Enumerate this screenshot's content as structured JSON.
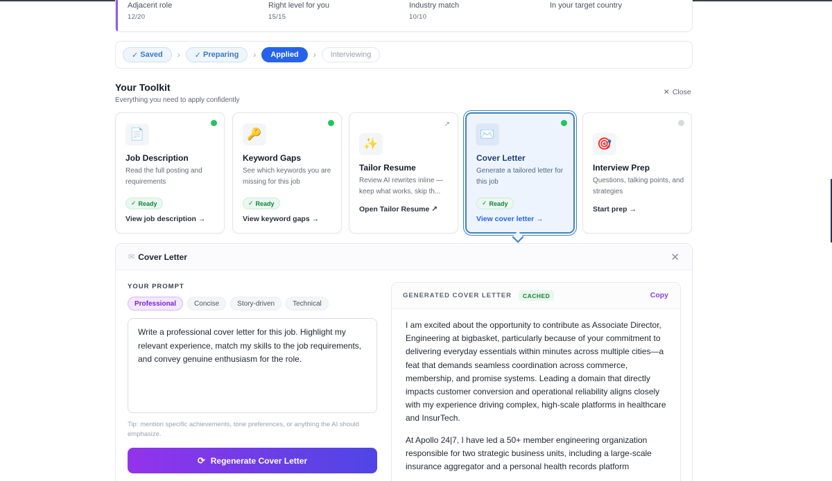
{
  "metrics": [
    {
      "label": "Adjacent role",
      "value": "12/20"
    },
    {
      "label": "Right level for you",
      "value": "15/15"
    },
    {
      "label": "Industry match",
      "value": "10/10"
    },
    {
      "label": "In your target country",
      "value": ""
    }
  ],
  "pipeline": {
    "stages": [
      {
        "label": "Saved",
        "state": "done"
      },
      {
        "label": "Preparing",
        "state": "done"
      },
      {
        "label": "Applied",
        "state": "active"
      },
      {
        "label": "Interviewing",
        "state": "future"
      }
    ]
  },
  "toolkit": {
    "title": "Your Toolkit",
    "subtitle": "Everything you need to apply confidently",
    "close_label": "Close",
    "cards": [
      {
        "icon": "📄",
        "name": "Job Description",
        "desc": "Read the full posting and requirements",
        "badge": "Ready",
        "link": "View job description →"
      },
      {
        "icon": "🔑",
        "name": "Keyword Gaps",
        "desc": "See which keywords you are missing for this job",
        "badge": "Ready",
        "link": "View keyword gaps →"
      },
      {
        "icon": "✨",
        "name": "Tailor Resume",
        "desc": "Review AI rewrites inline — keep what works, skip th...",
        "link": "Open Tailor Resume"
      },
      {
        "icon": "✉️",
        "name": "Cover Letter",
        "desc": "Generate a tailored letter for this job",
        "badge": "Ready",
        "link": "View cover letter →"
      },
      {
        "icon": "🎯",
        "name": "Interview Prep",
        "desc": "Questions, talking points, and strategies",
        "link": "Start prep →"
      }
    ]
  },
  "cover_letter": {
    "panel_title": "Cover Letter",
    "prompt_label": "YOUR PROMPT",
    "tones": [
      "Professional",
      "Concise",
      "Story-driven",
      "Technical"
    ],
    "selected_tone": "Professional",
    "prompt_text": "Write a professional cover letter for this job. Highlight my relevant experience, match my skills to the job requirements, and convey genuine enthusiasm for the role.",
    "tip": "Tip: mention specific achievements, tone preferences, or anything the AI should emphasize.",
    "regenerate_label": "Regenerate Cover Letter",
    "generated_title": "GENERATED COVER LETTER",
    "cached_label": "CACHED",
    "copy_label": "Copy",
    "paragraphs": [
      "I am excited about the opportunity to contribute as Associate Director, Engineering at bigbasket, particularly because of your commitment to delivering everyday essentials within minutes across multiple cities—a feat that demands seamless coordination across commerce, membership, and promise systems. Leading a domain that directly impacts customer conversion and operational reliability aligns closely with my experience driving complex, high-scale platforms in healthcare and InsurTech.",
      "At Apollo 24|7, I have led a 50+ member engineering organization responsible for two strategic business units, including a large-scale insurance aggregator and a personal health records platform"
    ]
  }
}
